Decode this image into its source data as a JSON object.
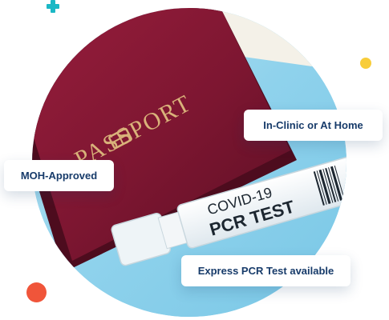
{
  "badges": {
    "clinic": "In-Clinic or At Home",
    "moh": "MOH-Approved",
    "express": "Express PCR Test available"
  },
  "photo": {
    "passport_text": "PASSPORT",
    "tube_line1": "COVID-19",
    "tube_line2": "PCR TEST"
  },
  "colors": {
    "badge_text": "#173b6a",
    "teal_plus": "#1bb8c5",
    "yellow_dot": "#f8cd3a",
    "red_dot": "#f0553a",
    "photo_background": "#8fd2ec",
    "passport": "#7d1631"
  }
}
